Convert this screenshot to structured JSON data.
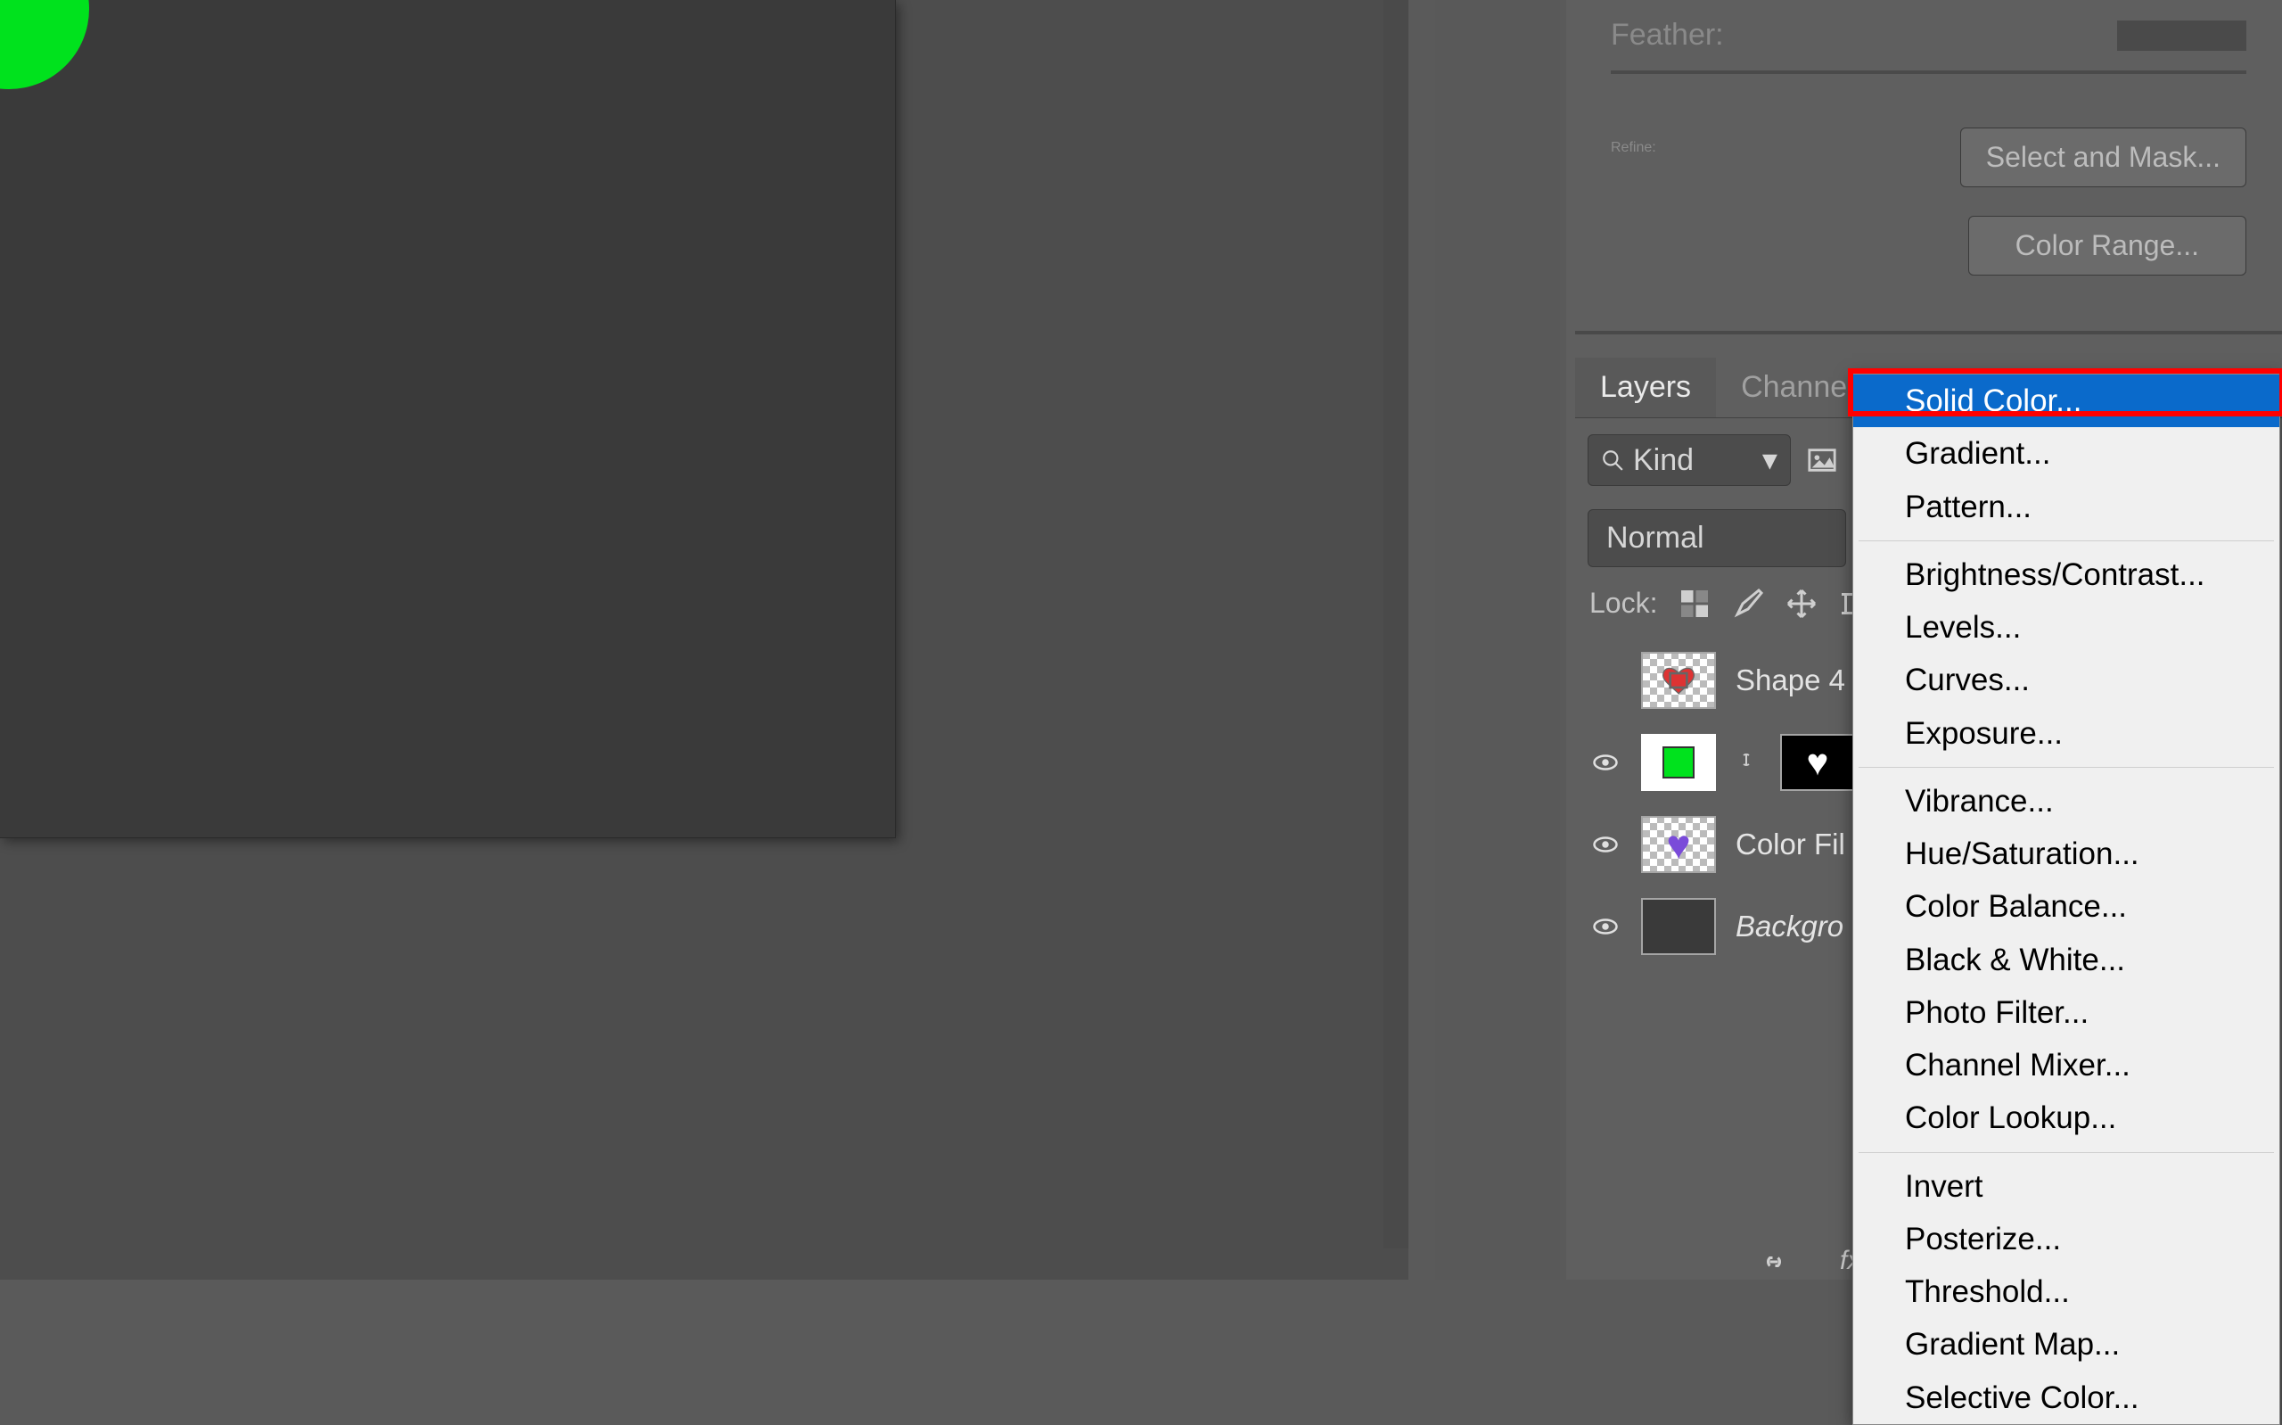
{
  "properties": {
    "feather_label": "Feather:",
    "refine_label": "Refine:",
    "select_and_mask": "Select and Mask...",
    "color_range": "Color Range..."
  },
  "tabs": {
    "layers": "Layers",
    "channels": "Channels"
  },
  "layers_panel": {
    "kind_label": "Kind",
    "blend_mode": "Normal",
    "lock_label": "Lock:",
    "layers": [
      {
        "name": "Shape 4",
        "visible": false,
        "type": "shape"
      },
      {
        "name": "",
        "visible": true,
        "type": "solid-green"
      },
      {
        "name": "Color Fil",
        "visible": true,
        "type": "purple-heart"
      },
      {
        "name": "Backgro",
        "visible": true,
        "type": "background",
        "italic": true
      }
    ]
  },
  "adjustment_menu": {
    "groups": [
      [
        "Solid Color...",
        "Gradient...",
        "Pattern..."
      ],
      [
        "Brightness/Contrast...",
        "Levels...",
        "Curves...",
        "Exposure..."
      ],
      [
        "Vibrance...",
        "Hue/Saturation...",
        "Color Balance...",
        "Black & White...",
        "Photo Filter...",
        "Channel Mixer...",
        "Color Lookup..."
      ],
      [
        "Invert",
        "Posterize...",
        "Threshold...",
        "Gradient Map...",
        "Selective Color..."
      ]
    ],
    "highlighted": "Solid Color..."
  }
}
